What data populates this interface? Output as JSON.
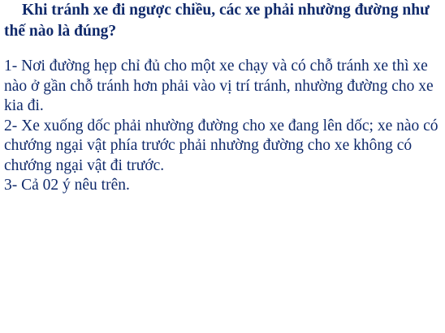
{
  "question": "Khi tránh xe đi ngược chiều, các xe phải nhường đường như thế nào là đúng?",
  "answers": [
    "1- Nơi đường hẹp chỉ đủ cho một xe chạy và có chỗ tránh xe thì xe nào ở gần chỗ tránh hơn phải vào vị trí tránh, nhường đường cho xe kia đi.",
    "2- Xe xuống dốc phải nhường đường cho xe đang lên dốc; xe nào có chướng ngại vật phía trước phải nhường đường cho xe  không có chướng ngại vật đi trước.",
    "3- Cả 02 ý nêu trên."
  ],
  "colors": {
    "text": "#102a6b",
    "background": "#ffffff"
  }
}
